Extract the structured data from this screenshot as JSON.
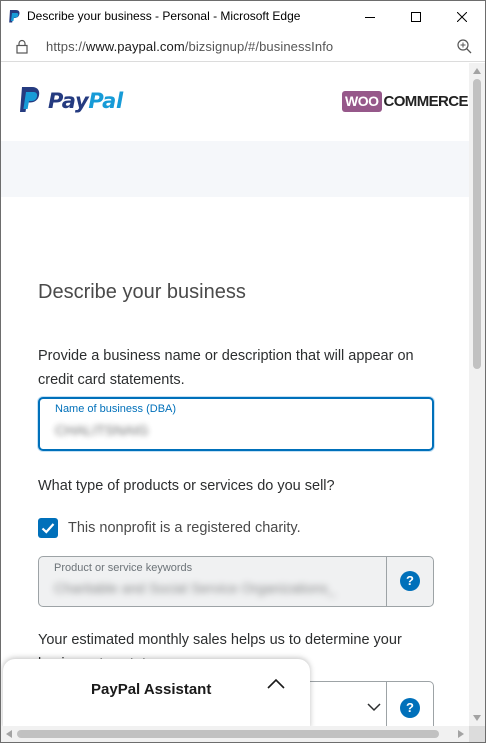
{
  "window": {
    "title": "Describe your business - Personal - Microsoft Edge",
    "url_prefix": "https://",
    "url_host": "www.paypal.com",
    "url_path": "/bizsignup/#/businessInfo"
  },
  "header": {
    "paypal_pay": "Pay",
    "paypal_pal": "Pal",
    "woo_badge": "WOO",
    "woo_text": "COMMERCE"
  },
  "form": {
    "heading": "Describe your business",
    "intro": "Provide a business name or description that will appear on credit card statements.",
    "business_name": {
      "label": "Name of business (DBA)",
      "value": "CHALITSNAIG"
    },
    "products_question": "What type of products or services do you sell?",
    "charity_checkbox": {
      "checked": true,
      "label": "This nonprofit is a registered charity."
    },
    "keywords": {
      "label": "Product or service keywords",
      "value": "Charitable and Social Service Organizations_",
      "help": "?"
    },
    "sales_text": "Your estimated monthly sales helps us to determine your business tax status.",
    "sales_help": "?"
  },
  "assistant": {
    "label": "PayPal Assistant"
  },
  "colors": {
    "accent": "#0070ba",
    "paypal_dark": "#253b80",
    "paypal_light": "#179bd7",
    "woo_purple": "#96588a"
  }
}
